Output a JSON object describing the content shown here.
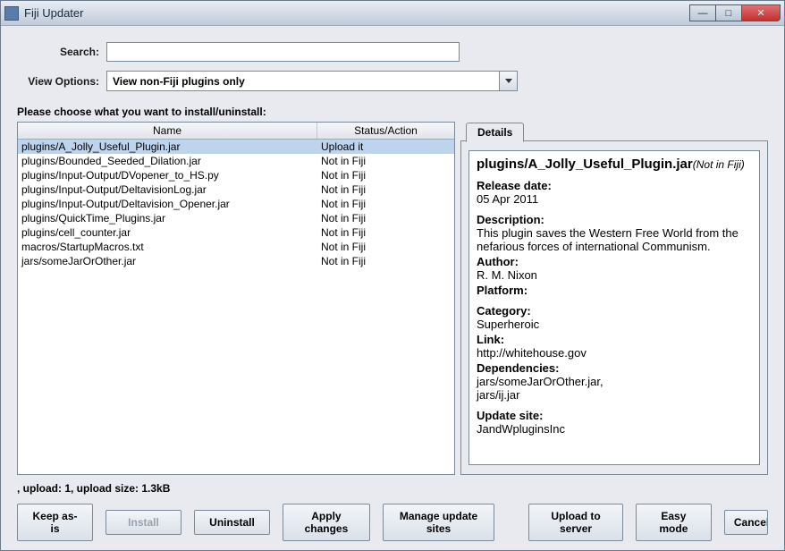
{
  "window": {
    "title": "Fiji Updater"
  },
  "search": {
    "label": "Search:",
    "value": ""
  },
  "viewOptions": {
    "label": "View Options:",
    "selected": "View non-Fiji plugins only"
  },
  "prompt": "Please choose what you want to install/uninstall:",
  "table": {
    "columns": {
      "name": "Name",
      "status": "Status/Action"
    },
    "rows": [
      {
        "name": "plugins/A_Jolly_Useful_Plugin.jar",
        "status": "Upload it",
        "selected": true
      },
      {
        "name": "plugins/Bounded_Seeded_Dilation.jar",
        "status": "Not in Fiji"
      },
      {
        "name": "plugins/Input-Output/DVopener_to_HS.py",
        "status": "Not in Fiji"
      },
      {
        "name": "plugins/Input-Output/DeltavisionLog.jar",
        "status": "Not in Fiji"
      },
      {
        "name": "plugins/Input-Output/Deltavision_Opener.jar",
        "status": "Not in Fiji"
      },
      {
        "name": "plugins/QuickTime_Plugins.jar",
        "status": "Not in Fiji"
      },
      {
        "name": "plugins/cell_counter.jar",
        "status": "Not in Fiji"
      },
      {
        "name": "macros/StartupMacros.txt",
        "status": "Not in Fiji"
      },
      {
        "name": "jars/someJarOrOther.jar",
        "status": "Not in Fiji"
      }
    ]
  },
  "details": {
    "tab": "Details",
    "title": "plugins/A_Jolly_Useful_Plugin.jar",
    "titleStatus": "(Not in Fiji)",
    "releaseDateLabel": "Release date:",
    "releaseDate": "05 Apr 2011",
    "descriptionLabel": "Description:",
    "description": "This plugin saves the Western Free World from the nefarious forces of international Communism.",
    "authorLabel": "Author:",
    "author": "R. M. Nixon",
    "platformLabel": "Platform:",
    "platform": "",
    "categoryLabel": "Category:",
    "category": "Superheroic",
    "linkLabel": "Link:",
    "link": "http://whitehouse.gov",
    "dependenciesLabel": "Dependencies:",
    "dependencies": "jars/someJarOrOther.jar,\njars/ij.jar",
    "updateSiteLabel": "Update site:",
    "updateSite": "JandWpluginsInc"
  },
  "footer": ", upload: 1, upload size: 1.3kB",
  "buttons": {
    "keep": "Keep as-is",
    "install": "Install",
    "uninstall": "Uninstall",
    "apply": "Apply changes",
    "manage": "Manage update sites",
    "upload": "Upload to server",
    "easy": "Easy mode",
    "cancel": "Cancel"
  }
}
